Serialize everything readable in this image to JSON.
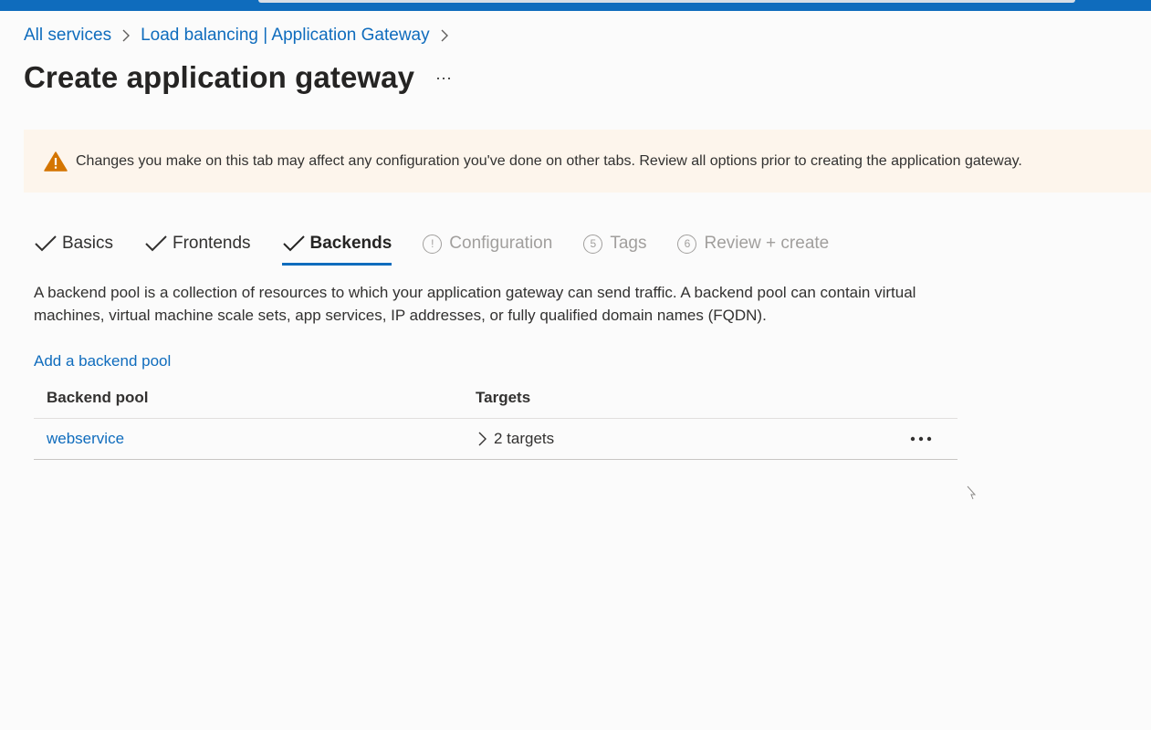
{
  "breadcrumb": {
    "items": [
      "All services",
      "Load balancing | Application Gateway"
    ]
  },
  "page": {
    "title": "Create application gateway",
    "more_label": "···"
  },
  "warning": {
    "text": "Changes you make on this tab may affect any configuration you've done on other tabs. Review all options prior to creating the application gateway.",
    "icon": "warning-triangle-icon",
    "color": "#d47500"
  },
  "tabs": [
    {
      "label": "Basics",
      "state": "done"
    },
    {
      "label": "Frontends",
      "state": "done"
    },
    {
      "label": "Backends",
      "state": "active"
    },
    {
      "label": "Configuration",
      "state": "pending",
      "marker": "!"
    },
    {
      "label": "Tags",
      "state": "pending",
      "marker": "5"
    },
    {
      "label": "Review + create",
      "state": "pending",
      "marker": "6"
    }
  ],
  "description": "A backend pool is a collection of resources to which your application gateway can send traffic. A backend pool can contain virtual machines, virtual machine scale sets, app services, IP addresses, or fully qualified domain names (FQDN).",
  "add_backend_pool_label": "Add a backend pool",
  "table": {
    "columns": [
      "Backend pool",
      "Targets"
    ],
    "rows": [
      {
        "pool": "webservice",
        "targets": "2 targets"
      }
    ]
  },
  "colors": {
    "accent": "#0f6cbd",
    "warning_bg": "#fdf5ec"
  }
}
